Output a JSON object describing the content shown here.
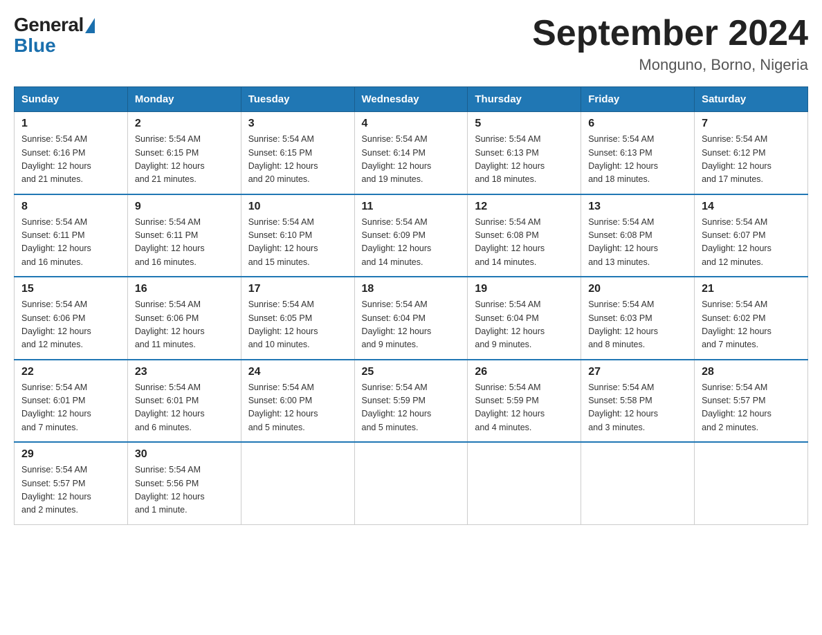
{
  "logo": {
    "general_text": "General",
    "blue_text": "Blue"
  },
  "title": "September 2024",
  "subtitle": "Monguno, Borno, Nigeria",
  "weekdays": [
    "Sunday",
    "Monday",
    "Tuesday",
    "Wednesday",
    "Thursday",
    "Friday",
    "Saturday"
  ],
  "weeks": [
    [
      {
        "day": "1",
        "sunrise": "5:54 AM",
        "sunset": "6:16 PM",
        "daylight": "12 hours and 21 minutes."
      },
      {
        "day": "2",
        "sunrise": "5:54 AM",
        "sunset": "6:15 PM",
        "daylight": "12 hours and 21 minutes."
      },
      {
        "day": "3",
        "sunrise": "5:54 AM",
        "sunset": "6:15 PM",
        "daylight": "12 hours and 20 minutes."
      },
      {
        "day": "4",
        "sunrise": "5:54 AM",
        "sunset": "6:14 PM",
        "daylight": "12 hours and 19 minutes."
      },
      {
        "day": "5",
        "sunrise": "5:54 AM",
        "sunset": "6:13 PM",
        "daylight": "12 hours and 18 minutes."
      },
      {
        "day": "6",
        "sunrise": "5:54 AM",
        "sunset": "6:13 PM",
        "daylight": "12 hours and 18 minutes."
      },
      {
        "day": "7",
        "sunrise": "5:54 AM",
        "sunset": "6:12 PM",
        "daylight": "12 hours and 17 minutes."
      }
    ],
    [
      {
        "day": "8",
        "sunrise": "5:54 AM",
        "sunset": "6:11 PM",
        "daylight": "12 hours and 16 minutes."
      },
      {
        "day": "9",
        "sunrise": "5:54 AM",
        "sunset": "6:11 PM",
        "daylight": "12 hours and 16 minutes."
      },
      {
        "day": "10",
        "sunrise": "5:54 AM",
        "sunset": "6:10 PM",
        "daylight": "12 hours and 15 minutes."
      },
      {
        "day": "11",
        "sunrise": "5:54 AM",
        "sunset": "6:09 PM",
        "daylight": "12 hours and 14 minutes."
      },
      {
        "day": "12",
        "sunrise": "5:54 AM",
        "sunset": "6:08 PM",
        "daylight": "12 hours and 14 minutes."
      },
      {
        "day": "13",
        "sunrise": "5:54 AM",
        "sunset": "6:08 PM",
        "daylight": "12 hours and 13 minutes."
      },
      {
        "day": "14",
        "sunrise": "5:54 AM",
        "sunset": "6:07 PM",
        "daylight": "12 hours and 12 minutes."
      }
    ],
    [
      {
        "day": "15",
        "sunrise": "5:54 AM",
        "sunset": "6:06 PM",
        "daylight": "12 hours and 12 minutes."
      },
      {
        "day": "16",
        "sunrise": "5:54 AM",
        "sunset": "6:06 PM",
        "daylight": "12 hours and 11 minutes."
      },
      {
        "day": "17",
        "sunrise": "5:54 AM",
        "sunset": "6:05 PM",
        "daylight": "12 hours and 10 minutes."
      },
      {
        "day": "18",
        "sunrise": "5:54 AM",
        "sunset": "6:04 PM",
        "daylight": "12 hours and 9 minutes."
      },
      {
        "day": "19",
        "sunrise": "5:54 AM",
        "sunset": "6:04 PM",
        "daylight": "12 hours and 9 minutes."
      },
      {
        "day": "20",
        "sunrise": "5:54 AM",
        "sunset": "6:03 PM",
        "daylight": "12 hours and 8 minutes."
      },
      {
        "day": "21",
        "sunrise": "5:54 AM",
        "sunset": "6:02 PM",
        "daylight": "12 hours and 7 minutes."
      }
    ],
    [
      {
        "day": "22",
        "sunrise": "5:54 AM",
        "sunset": "6:01 PM",
        "daylight": "12 hours and 7 minutes."
      },
      {
        "day": "23",
        "sunrise": "5:54 AM",
        "sunset": "6:01 PM",
        "daylight": "12 hours and 6 minutes."
      },
      {
        "day": "24",
        "sunrise": "5:54 AM",
        "sunset": "6:00 PM",
        "daylight": "12 hours and 5 minutes."
      },
      {
        "day": "25",
        "sunrise": "5:54 AM",
        "sunset": "5:59 PM",
        "daylight": "12 hours and 5 minutes."
      },
      {
        "day": "26",
        "sunrise": "5:54 AM",
        "sunset": "5:59 PM",
        "daylight": "12 hours and 4 minutes."
      },
      {
        "day": "27",
        "sunrise": "5:54 AM",
        "sunset": "5:58 PM",
        "daylight": "12 hours and 3 minutes."
      },
      {
        "day": "28",
        "sunrise": "5:54 AM",
        "sunset": "5:57 PM",
        "daylight": "12 hours and 2 minutes."
      }
    ],
    [
      {
        "day": "29",
        "sunrise": "5:54 AM",
        "sunset": "5:57 PM",
        "daylight": "12 hours and 2 minutes."
      },
      {
        "day": "30",
        "sunrise": "5:54 AM",
        "sunset": "5:56 PM",
        "daylight": "12 hours and 1 minute."
      },
      null,
      null,
      null,
      null,
      null
    ]
  ],
  "labels": {
    "sunrise": "Sunrise:",
    "sunset": "Sunset:",
    "daylight": "Daylight:"
  }
}
